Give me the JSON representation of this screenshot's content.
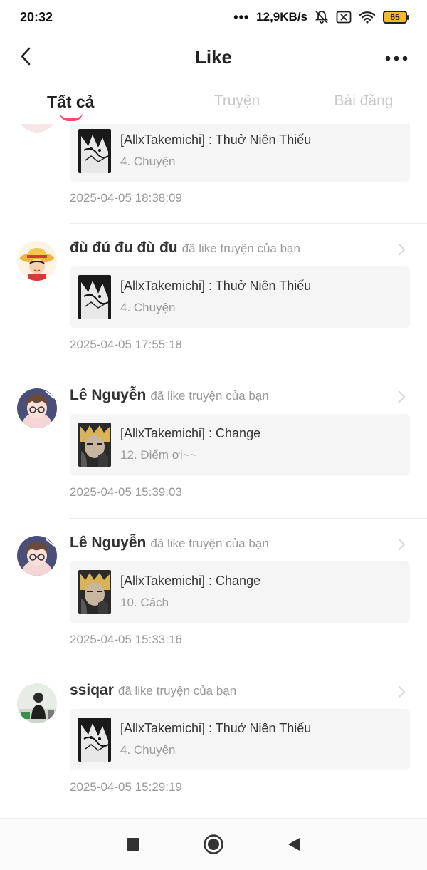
{
  "status_bar": {
    "time": "20:32",
    "network_speed": "12,9KB/s",
    "battery_level": "65",
    "icons": [
      "signal-dots-icon",
      "bell-muted-icon",
      "sim-off-icon",
      "wifi-icon",
      "battery-icon"
    ]
  },
  "header": {
    "title": "Like",
    "back_icon": "chevron-left-icon",
    "more_icon": "more-horizontal-icon"
  },
  "tabs": [
    {
      "label": "Tất cả",
      "active": true
    },
    {
      "label": "Truyện",
      "active": false
    },
    {
      "label": "Bài đăng",
      "active": false
    }
  ],
  "accent_color": "#f04e6e",
  "feed": [
    {
      "username": "",
      "action": "",
      "story_title": "[AllxTakemichi] : Thuở Niên Thiếu",
      "chapter": "4. Chuyện",
      "timestamp": "2025-04-05 18:38:09",
      "avatar": "anime-girl-avatar",
      "thumb": "bw-manga-cover"
    },
    {
      "username": "đù đú đu đù đu",
      "action": "đã like truyện của bạn",
      "story_title": "[AllxTakemichi] : Thuở Niên Thiếu",
      "chapter": "4. Chuyện",
      "timestamp": "2025-04-05 17:55:18",
      "avatar": "straw-hat-avatar",
      "thumb": "bw-manga-cover"
    },
    {
      "username": "Lê Nguyễn",
      "action": "đã like truyện của bạn",
      "story_title": "[AllxTakemichi] : Change",
      "chapter": "12. Điểm ơi~~",
      "timestamp": "2025-04-05 15:39:03",
      "avatar": "anime-glasses-avatar",
      "thumb": "blond-character-cover"
    },
    {
      "username": "Lê Nguyễn",
      "action": "đã like truyện của bạn",
      "story_title": "[AllxTakemichi] : Change",
      "chapter": "10. Cách",
      "timestamp": "2025-04-05 15:33:16",
      "avatar": "anime-glasses-avatar",
      "thumb": "blond-character-cover"
    },
    {
      "username": "ssiqar",
      "action": "đã like truyện của bạn",
      "story_title": "[AllxTakemichi] : Thuở Niên Thiếu",
      "chapter": "4. Chuyện",
      "timestamp": "2025-04-05 15:29:19",
      "avatar": "photo-person-avatar",
      "thumb": "bw-manga-cover"
    }
  ],
  "nav_bar": {
    "buttons": [
      "recents-square-icon",
      "home-circle-icon",
      "back-triangle-icon"
    ]
  }
}
